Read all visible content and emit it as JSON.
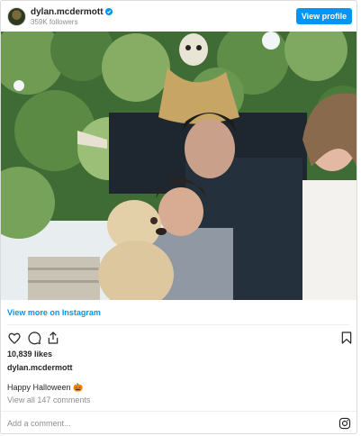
{
  "header": {
    "username": "dylan.mcdermott",
    "followers": "359K followers",
    "view_profile_label": "View profile"
  },
  "post": {
    "view_more_label": "View more on Instagram",
    "likes": "10,839 likes",
    "poster": "dylan.mcdermott",
    "caption": "Happy Halloween 🎃",
    "view_comments": "View all 147 comments",
    "add_comment_placeholder": "Add a comment..."
  },
  "icons": {
    "verified": "verified-badge-icon",
    "like": "heart-icon",
    "comment": "comment-icon",
    "share": "share-icon",
    "save": "bookmark-icon",
    "instagram": "instagram-logo-icon"
  },
  "colors": {
    "accent": "#0095f6",
    "text": "#262626",
    "muted": "#8e8e8e"
  }
}
